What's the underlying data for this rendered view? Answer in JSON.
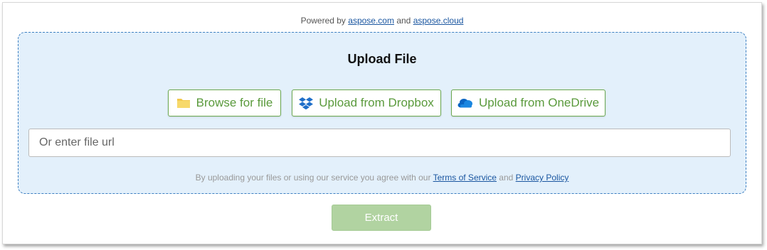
{
  "powered": {
    "prefix": "Powered by",
    "link1": "aspose.com",
    "conj": "and",
    "link2": "aspose.cloud"
  },
  "upload": {
    "title": "Upload File",
    "browse_label": "Browse for file",
    "dropbox_label": "Upload from Dropbox",
    "onedrive_label": "Upload from OneDrive",
    "url_placeholder": "Or enter file url",
    "terms_prefix": "By uploading your files or using our service you agree with our",
    "terms_link": "Terms of Service",
    "terms_conj": "and",
    "privacy_link": "Privacy Policy"
  },
  "actions": {
    "extract_label": "Extract",
    "extract_enabled": false
  },
  "icons": {
    "browse": "folder-icon",
    "dropbox": "dropbox-icon",
    "onedrive": "onedrive-icon"
  },
  "colors": {
    "accent_green": "#5a9a3c",
    "box_background": "#e3f0fb",
    "box_border": "#3d7fc1",
    "link": "#1a56a0",
    "extract_disabled": "#b1d3a1"
  }
}
